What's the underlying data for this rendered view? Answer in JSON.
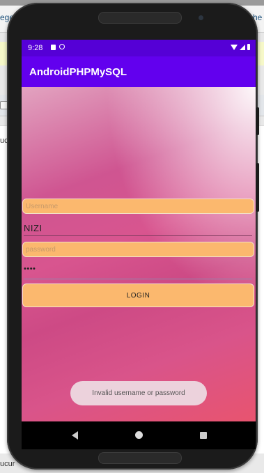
{
  "background": {
    "fragments": {
      "left_top": "ege",
      "right_top": "he",
      "left_mid": "uc",
      "bottom_left": "ucur"
    }
  },
  "status_bar": {
    "time": "9:28"
  },
  "app_bar": {
    "title": "AndroidPHPMySQL"
  },
  "login_form": {
    "username_placeholder": "Username",
    "username_value": "NIZI",
    "password_placeholder": "password",
    "password_value": "••••",
    "login_button": "LOGIN"
  },
  "toast": {
    "message": "Invalid username or password"
  },
  "colors": {
    "app_bar": "#6200ee",
    "status_bar": "#5500d6",
    "field": "#fbb86e",
    "toast": "#ecd2dc"
  },
  "icons": [
    "lock-status-icon",
    "sync-status-icon",
    "wifi-icon",
    "cell-signal-icon",
    "battery-icon",
    "back-nav-icon",
    "home-nav-icon",
    "recents-nav-icon"
  ]
}
